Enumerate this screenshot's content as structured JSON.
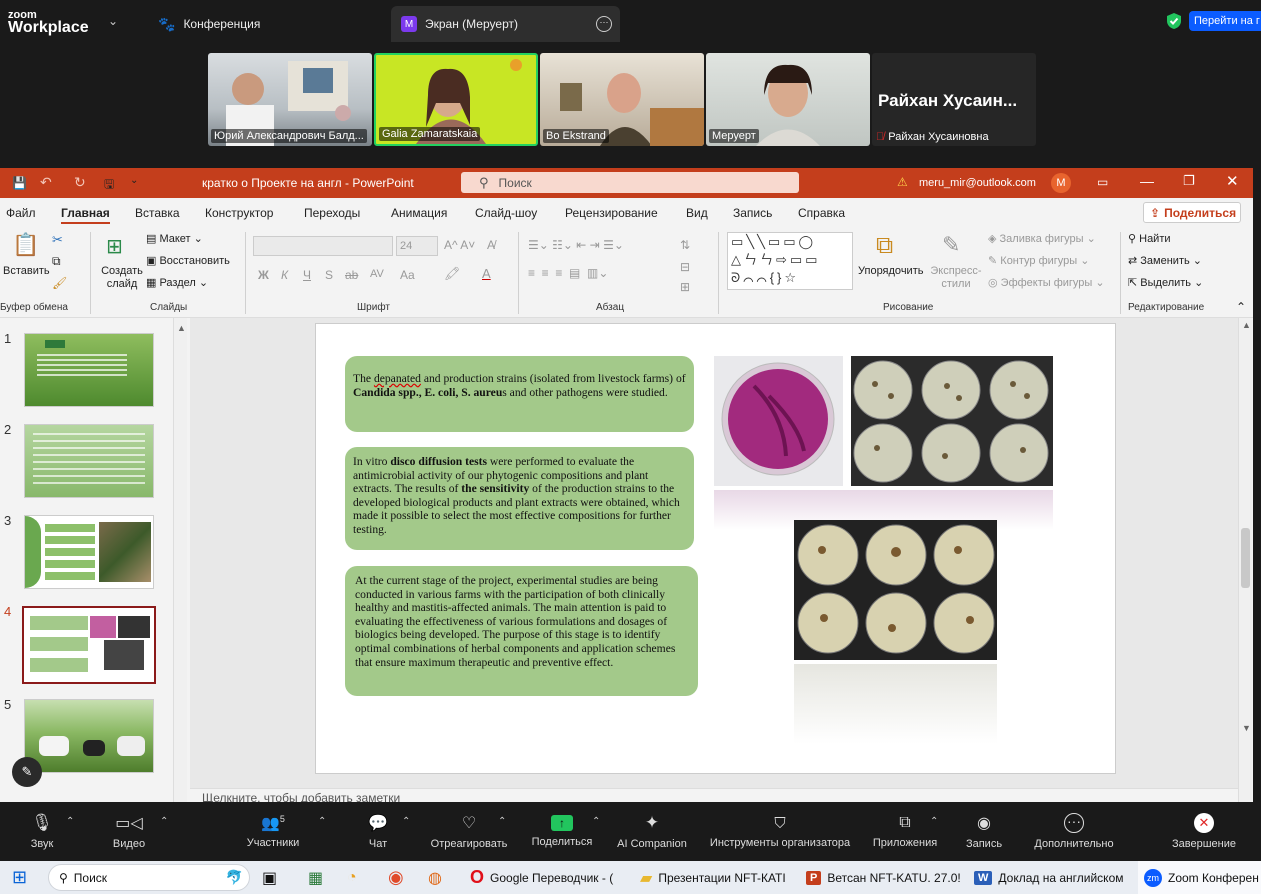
{
  "zoom": {
    "logo_top": "zoom",
    "logo_bottom": "Workplace",
    "tabs": [
      {
        "label": "Конференция"
      },
      {
        "label": "Экран (Меруерт)",
        "badge": "M"
      }
    ],
    "goto_button": "Перейти на г",
    "participants": [
      {
        "name": "Юрий Александрович Балд..."
      },
      {
        "name": "Galia Zamaratskaia"
      },
      {
        "name": "Bo Ekstrand"
      },
      {
        "name": "Меруерт"
      },
      {
        "name": "Райхан Хусаин...",
        "subname": "Райхан Хусаиновна"
      }
    ],
    "toolbar": {
      "audio": "Звук",
      "video": "Видео",
      "participants": "Участники",
      "participants_count": "5",
      "chat": "Чат",
      "react": "Отреагировать",
      "share": "Поделиться",
      "ai": "AI Companion",
      "host_tools": "Инструменты организатора",
      "apps": "Приложения",
      "record": "Запись",
      "more": "Дополнительно",
      "end": "Завершение"
    }
  },
  "ppt": {
    "title": "кратко о Проекте на англ  -  PowerPoint",
    "search_placeholder": "Поиск",
    "account": "meru_mir@outlook.com",
    "avatar": "M",
    "menu": [
      "Файл",
      "Главная",
      "Вставка",
      "Конструктор",
      "Переходы",
      "Анимация",
      "Слайд-шоу",
      "Рецензирование",
      "Вид",
      "Запись",
      "Справка"
    ],
    "share_button": "Поделиться",
    "ribbon": {
      "paste": "Вставить",
      "clipboard": "Буфер обмена",
      "new_slide": "Создать слайд",
      "layout": "Макет",
      "reset": "Восстановить",
      "section": "Раздел",
      "slides": "Слайды",
      "font": "Шрифт",
      "font_size": "24",
      "paragraph": "Абзац",
      "arrange": "Упорядочить",
      "quick_styles": "Экспресс-стили",
      "shape_fill": "Заливка фигуры",
      "shape_outline": "Контур фигуры",
      "shape_effects": "Эффекты фигуры",
      "drawing": "Рисование",
      "find": "Найти",
      "replace": "Заменить",
      "select": "Выделить",
      "editing": "Редактирование",
      "font_buttons": [
        "Ж",
        "К",
        "Ч",
        "S",
        "ab",
        "AV",
        "Aa"
      ]
    },
    "slide_numbers": [
      "1",
      "2",
      "3",
      "4",
      "5"
    ],
    "notes_placeholder": "Щелкните, чтобы добавить заметки",
    "box1": {
      "p1": "The ",
      "u1": "depanated",
      "p2": " and production strains (isolated from livestock farms) of ",
      "b1": "Candida spp., E. coli, S. aureu",
      "p3": "s and other pathogens were studied."
    },
    "box2": {
      "p1": "In vitro ",
      "b1": "disco diffusion tests",
      "p2": " were performed to evaluate the antimicrobial activity of our phytogenic compositions and plant extracts. The results of ",
      "b2": "the sensitivity",
      "p3": " of the production strains to the developed biological products and plant extracts were obtained, which made it possible to select the most effective compositions for further testing."
    },
    "box3": "At the current stage of the project, experimental studies are being conducted in various farms with the participation of both clinically healthy and mastitis-affected animals. The main attention is paid to evaluating the effectiveness of various formulations and dosages of biologics being developed. The purpose of this stage is to identify optimal combinations of herbal components and application schemes that ensure maximum therapeutic and preventive effect."
  },
  "taskbar": {
    "search": "Поиск",
    "items": [
      "Google Переводчик - (",
      "Презентации NFT-КАТІ",
      "Ветсан NFT-KATU. 27.0!",
      "Доклад на английском",
      "Zoom Конферен"
    ]
  },
  "colors": {
    "ppt_accent": "#c43e1c",
    "box_green": "#a3c98a",
    "zoom_bg": "#1a1a1a",
    "zoom_blue": "#0b5cff"
  }
}
